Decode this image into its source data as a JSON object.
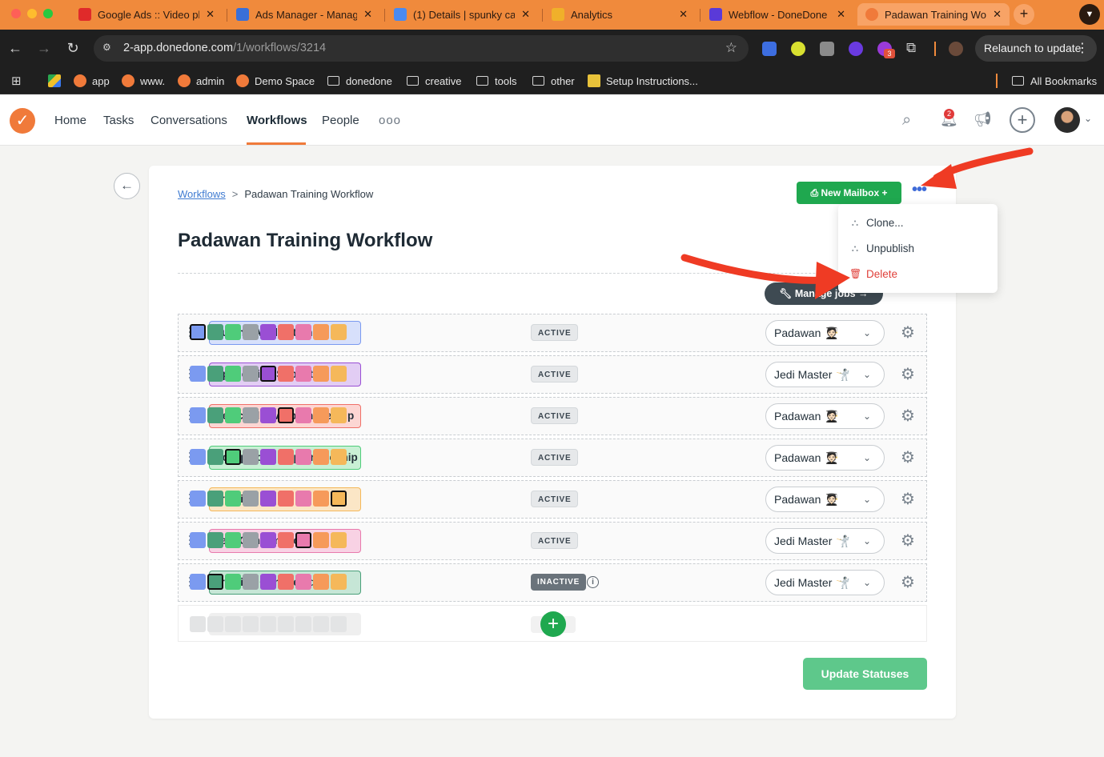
{
  "browser": {
    "tabs": [
      {
        "title": "Google Ads :: Video pl",
        "favicon_color": "#e02a2a"
      },
      {
        "title": "Ads Manager - Manag",
        "favicon_color": "#3a6fd8"
      },
      {
        "title": "(1) Details | spunky ca",
        "favicon_color": "#4a8af0"
      },
      {
        "title": "Analytics",
        "favicon_color": "#f0b02a"
      },
      {
        "title": "Webflow - DoneDone",
        "favicon_color": "#5a3ad8"
      },
      {
        "title": "Padawan Training Wor",
        "favicon_color": "#f07a3a",
        "active": true
      }
    ],
    "url_host": "2-app.donedone.com",
    "url_path": "/1/workflows/3214",
    "relaunch_label": "Relaunch to update",
    "extension_badge": "3",
    "bookmarks": [
      {
        "label": "app",
        "type": "site",
        "color": "#f07a3a"
      },
      {
        "label": "www.",
        "type": "site",
        "color": "#f07a3a"
      },
      {
        "label": "admin",
        "type": "site",
        "color": "#f07a3a"
      },
      {
        "label": "Demo Space",
        "type": "site",
        "color": "#f07a3a"
      },
      {
        "label": "donedone",
        "type": "folder"
      },
      {
        "label": "creative",
        "type": "folder"
      },
      {
        "label": "tools",
        "type": "folder"
      },
      {
        "label": "other",
        "type": "folder"
      },
      {
        "label": "Setup Instructions...",
        "type": "site",
        "color": "#e8c23a"
      }
    ],
    "all_bookmarks_label": "All Bookmarks"
  },
  "nav": {
    "items": [
      "Home",
      "Tasks",
      "Conversations",
      "Workflows",
      "People"
    ],
    "active": "Workflows",
    "notification_count": "2",
    "accent": "#f07a3a"
  },
  "breadcrumb": {
    "parent": "Workflows",
    "current": "Padawan Training Workflow"
  },
  "page_title": "Padawan Training Workflow",
  "buttons": {
    "new_mailbox": "New Mailbox",
    "manage_jobs": "Manage jobs",
    "update_statuses": "Update Statuses"
  },
  "more_menu": {
    "items": [
      {
        "label": "Clone...",
        "icon": "workflow-icon"
      },
      {
        "label": "Unpublish",
        "icon": "workflow-icon"
      },
      {
        "label": "Delete",
        "icon": "trash-icon",
        "danger": true
      }
    ]
  },
  "palette": [
    "#7b9af0",
    "#4aa07a",
    "#4fcc7a",
    "#9aa1a6",
    "#9a4fd4",
    "#f07068",
    "#e87aad",
    "#f69a5a",
    "#f5b85a"
  ],
  "statuses": [
    {
      "name": "Submit Application",
      "fill": "#d7e0fb",
      "border": "#7b9af0",
      "selected_color": 0,
      "state": "ACTIVE",
      "role": "Padawan",
      "role_emoji": "🧑🏻‍🎓"
    },
    {
      "name": "Application Submitted",
      "fill": "#e2cdf4",
      "border": "#9a4fd4",
      "selected_color": 4,
      "state": "ACTIVE",
      "role": "Jedi Master",
      "role_emoji": "🤺"
    },
    {
      "name": "Rejected to Apprenticeship",
      "fill": "#fcd6d3",
      "border": "#f07068",
      "selected_color": 5,
      "state": "ACTIVE",
      "role": "Padawan",
      "role_emoji": "🧑🏻‍🎓"
    },
    {
      "name": "Accepted to Apprenticeship",
      "fill": "#c9f0d5",
      "border": "#4fcc7a",
      "selected_color": 2,
      "state": "ACTIVE",
      "role": "Padawan",
      "role_emoji": "🧑🏻‍🎓"
    },
    {
      "name": "Training",
      "fill": "#fbe6c6",
      "border": "#f5b85a",
      "selected_color": 8,
      "state": "ACTIVE",
      "role": "Padawan",
      "role_emoji": "🧑🏻‍🎓"
    },
    {
      "name": "Jedi Confirmation",
      "fill": "#f8d2e4",
      "border": "#e87aad",
      "selected_color": 6,
      "state": "ACTIVE",
      "role": "Jedi Master",
      "role_emoji": "🤺"
    },
    {
      "name": "Training Completed",
      "fill": "#c6e6d6",
      "border": "#4aa07a",
      "selected_color": 1,
      "state": "INACTIVE",
      "role": "Jedi Master",
      "role_emoji": "🤺"
    }
  ],
  "annotation_color": "#ef3b24"
}
